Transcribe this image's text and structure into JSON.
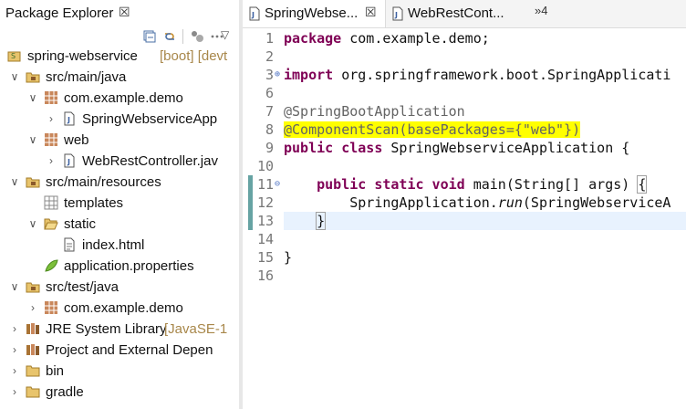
{
  "explorer": {
    "title": "Package Explorer",
    "close_glyph": "☒"
  },
  "tree": [
    {
      "label": "spring-webservice",
      "decoration": "[boot] [devt",
      "icon": "project-icon",
      "expanded": true,
      "level": 0
    },
    {
      "label": "src/main/java",
      "decoration": "",
      "icon": "source-folder-icon",
      "expanded": true,
      "level": 1
    },
    {
      "label": "com.example.demo",
      "decoration": "",
      "icon": "package-icon",
      "expanded": true,
      "level": 2
    },
    {
      "label": "SpringWebserviceApp",
      "decoration": "",
      "icon": "java-file-icon",
      "expanded": false,
      "level": 3
    },
    {
      "label": "web",
      "decoration": "",
      "icon": "package-icon",
      "expanded": true,
      "level": 2
    },
    {
      "label": "WebRestController.jav",
      "decoration": "",
      "icon": "java-file-icon",
      "expanded": false,
      "level": 3
    },
    {
      "label": "src/main/resources",
      "decoration": "",
      "icon": "source-folder-icon",
      "expanded": true,
      "level": 1
    },
    {
      "label": "templates",
      "decoration": "",
      "icon": "empty-package-icon",
      "expanded": null,
      "level": 2
    },
    {
      "label": "static",
      "decoration": "",
      "icon": "folder-open-icon",
      "expanded": true,
      "level": 2
    },
    {
      "label": "index.html",
      "decoration": "",
      "icon": "html-file-icon",
      "expanded": null,
      "level": 3
    },
    {
      "label": "application.properties",
      "decoration": "",
      "icon": "properties-file-icon",
      "expanded": null,
      "level": 2
    },
    {
      "label": "src/test/java",
      "decoration": "",
      "icon": "source-folder-icon",
      "expanded": true,
      "level": 1
    },
    {
      "label": "com.example.demo",
      "decoration": "",
      "icon": "package-icon",
      "expanded": false,
      "level": 2
    },
    {
      "label": "JRE System Library",
      "decoration": "[JavaSE-1",
      "icon": "library-icon",
      "expanded": false,
      "level": 1
    },
    {
      "label": "Project and External Depen",
      "decoration": "",
      "icon": "library-icon",
      "expanded": false,
      "level": 1
    },
    {
      "label": "bin",
      "decoration": "",
      "icon": "folder-icon",
      "expanded": false,
      "level": 1
    },
    {
      "label": "gradle",
      "decoration": "",
      "icon": "folder-icon",
      "expanded": false,
      "level": 1
    }
  ],
  "editor": {
    "tabs": [
      {
        "label": "SpringWebse...",
        "close_glyph": "☒",
        "active": true
      },
      {
        "label": "WebRestCont...",
        "close_glyph": "",
        "active": false
      }
    ],
    "overflow_label": "»4"
  },
  "code": {
    "line_numbers": [
      "1",
      "2",
      "3",
      "6",
      "7",
      "8",
      "9",
      "10",
      "11",
      "12",
      "13",
      "14",
      "15",
      "16"
    ],
    "l1_kw": "package",
    "l1_rest": " com.example.demo;",
    "l3_kw": "import",
    "l3_rest": " org.springframework.boot.SpringApplicati",
    "l7": "@SpringBootApplication",
    "l8": "@ComponentScan(basePackages={\"web\"})",
    "l9_kw": "public class",
    "l9_rest": " SpringWebserviceApplication {",
    "l11_kw": "public static void",
    "l11_rest": " main(String[] args) ",
    "l11_brace": "{",
    "l12_a": "SpringApplication.",
    "l12_b": "run",
    "l12_c": "(SpringWebserviceA",
    "l13": "}",
    "l15": "}"
  },
  "colors": {
    "keyword": "#7f0055",
    "annotation": "#646464",
    "highlight": "#ffff00",
    "change_bar": "#66a3a3"
  }
}
